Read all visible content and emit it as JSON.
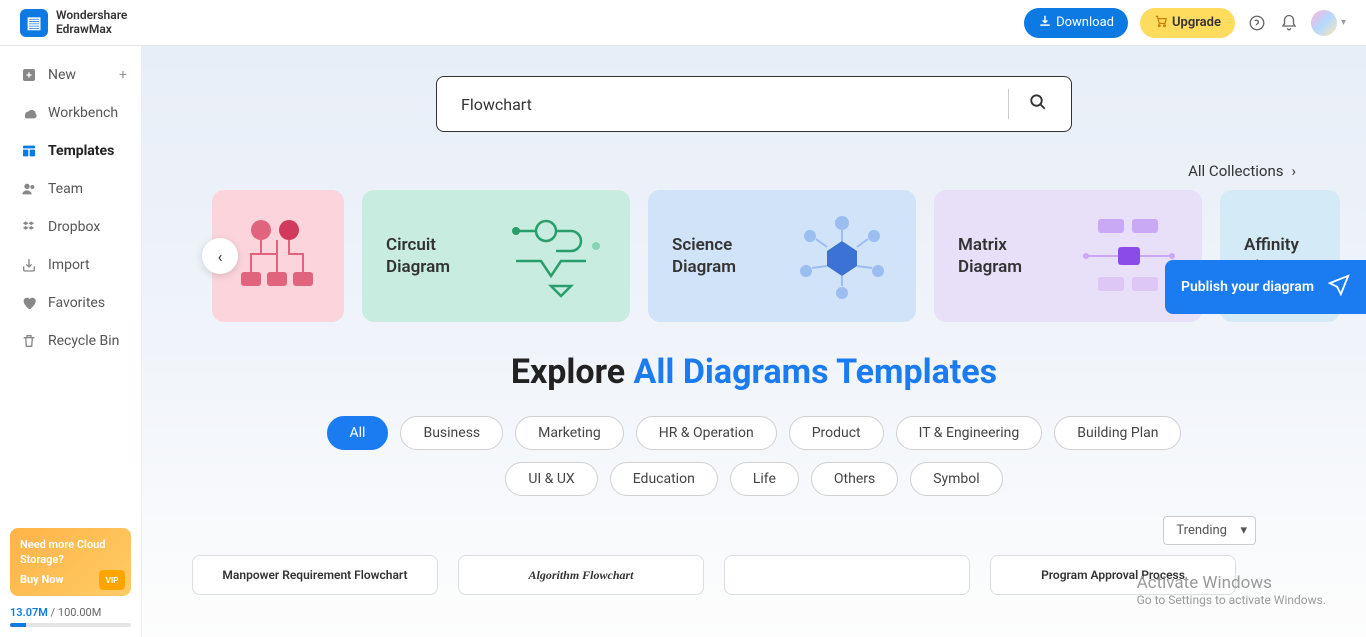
{
  "brand": {
    "line1": "Wondershare",
    "line2": "EdrawMax"
  },
  "topbar": {
    "download": "Download",
    "upgrade": "Upgrade"
  },
  "sidebar": {
    "items": [
      {
        "label": "New",
        "icon": "plus-square"
      },
      {
        "label": "Workbench",
        "icon": "cloud"
      },
      {
        "label": "Templates",
        "icon": "template",
        "active": true
      },
      {
        "label": "Team",
        "icon": "team"
      },
      {
        "label": "Dropbox",
        "icon": "dropbox"
      },
      {
        "label": "Import",
        "icon": "import"
      },
      {
        "label": "Favorites",
        "icon": "heart"
      },
      {
        "label": "Recycle Bin",
        "icon": "trash"
      }
    ],
    "promo": {
      "title": "Need more Cloud Storage?",
      "buy": "Buy Now",
      "vip": "VIP"
    },
    "storage": {
      "used": "13.07M",
      "sep": " / ",
      "total": "100.00M"
    }
  },
  "search": {
    "value": "Flowchart"
  },
  "all_collections": "All Collections",
  "carousel": [
    {
      "label": ""
    },
    {
      "label": "Circuit Diagram"
    },
    {
      "label": "Science Diagram"
    },
    {
      "label": "Matrix Diagram"
    },
    {
      "label": "Affinity Di..."
    }
  ],
  "heading": {
    "part1": "Explore ",
    "part2": "All Diagrams Templates"
  },
  "chips": [
    "All",
    "Business",
    "Marketing",
    "HR & Operation",
    "Product",
    "IT & Engineering",
    "Building Plan",
    "UI & UX",
    "Education",
    "Life",
    "Others",
    "Symbol"
  ],
  "sort": "Trending",
  "templates": [
    "Manpower Requirement Flowchart",
    "Algorithm Flowchart",
    "",
    "Program Approval Process"
  ],
  "publish": "Publish your diagram",
  "activate": {
    "t1": "Activate Windows",
    "t2": "Go to Settings to activate Windows."
  }
}
